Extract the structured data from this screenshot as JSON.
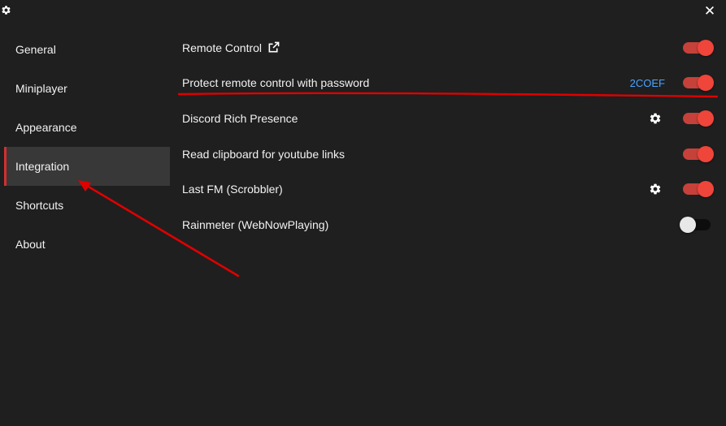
{
  "window": {
    "close_glyph": "✕"
  },
  "icons": {
    "window": "gear-icon",
    "external": "external-link-icon",
    "settings": "gear-icon"
  },
  "colors": {
    "background": "#1f1f1f",
    "sidebar_active": "#383838",
    "accent": "#f0453a",
    "link_blue": "#4aa3ff",
    "annotation": "#e00000"
  },
  "sidebar": {
    "items": [
      {
        "label": "General",
        "active": false
      },
      {
        "label": "Miniplayer",
        "active": false
      },
      {
        "label": "Appearance",
        "active": false
      },
      {
        "label": "Integration",
        "active": true
      },
      {
        "label": "Shortcuts",
        "active": false
      },
      {
        "label": "About",
        "active": false
      }
    ]
  },
  "settings": {
    "rows": [
      {
        "label": "Remote Control",
        "external_link": true,
        "enabled": true
      },
      {
        "label": "Protect remote control with password",
        "value": "2COEF",
        "enabled": true
      },
      {
        "label": "Discord Rich Presence",
        "has_settings": true,
        "enabled": true
      },
      {
        "label": "Read clipboard for youtube links",
        "enabled": true
      },
      {
        "label": "Last FM (Scrobbler)",
        "has_settings": true,
        "enabled": true
      },
      {
        "label": "Rainmeter (WebNowPlaying)",
        "enabled": false
      }
    ]
  }
}
